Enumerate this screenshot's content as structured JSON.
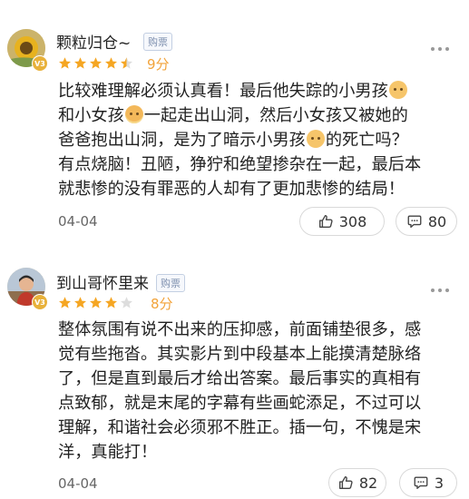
{
  "reviews": [
    {
      "username": "颗粒归仓~",
      "badge": "购票",
      "level": "V3",
      "stars": 4.5,
      "score": "9分",
      "content_lines": [
        [
          "比较难理解必须认真看！最后他失踪的小男孩",
          "boy-emoji"
        ],
        [
          "和小女孩",
          "girl-emoji",
          "一起走出山洞，然后小女孩又被她的"
        ],
        [
          "爸爸抱出山洞，是为了暗示小男孩",
          "boy-emoji",
          "的死亡吗？"
        ],
        [
          "有点烧脑！丑陋，狰狞和绝望掺杂在一起，最后本"
        ],
        [
          "就悲惨的没有罪恶的人却有了更加悲惨的结局！"
        ]
      ],
      "date": "04-04",
      "likes": "308",
      "comments": "80"
    },
    {
      "username": "到山哥怀里来",
      "badge": "购票",
      "level": "V3",
      "stars": 4,
      "score": "8分",
      "content_lines": [
        [
          "整体氛围有说不出来的压抑感，前面铺垫很多，感"
        ],
        [
          "觉有些拖沓。其实影片到中段基本上能摸清楚脉络"
        ],
        [
          "了，但是直到最后才给出答案。最后事实的真相有"
        ],
        [
          "点致郁，就是末尾的字幕有些画蛇添足，不过可以"
        ],
        [
          "理解，和谐社会必须邪不胜正。插一句，不愧是宋"
        ],
        [
          "洋，真能打！"
        ]
      ],
      "date": "04-04",
      "likes": "82",
      "comments": "3"
    }
  ],
  "colors": {
    "star_filled": "#f5a623",
    "star_empty": "#dddddd",
    "score": "#f2a33a",
    "badge_text": "#7d8fae"
  }
}
